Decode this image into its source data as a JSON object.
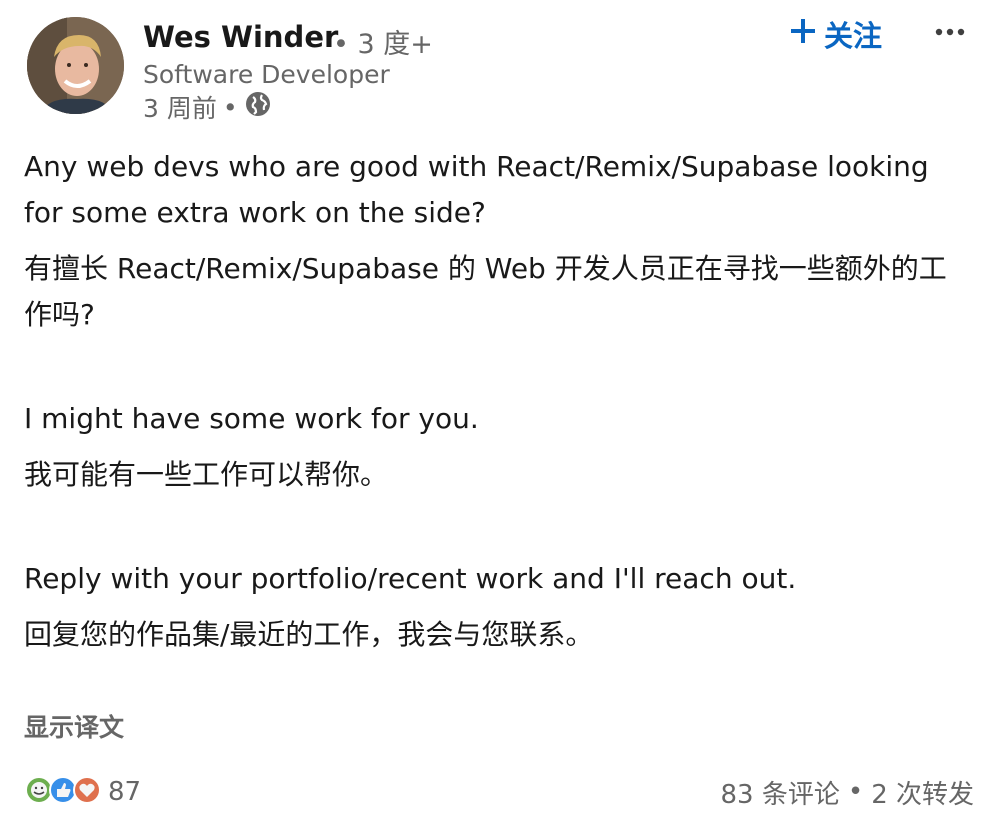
{
  "author": {
    "name": "Wes Winder",
    "degree": "• 3 度+",
    "headline": "Software Developer",
    "timestamp": "3 周前",
    "separator": "•",
    "visibility_icon": "globe-icon"
  },
  "actions": {
    "follow_label": "关注",
    "follow_icon": "plus-icon",
    "more_icon": "more-horizontal-icon"
  },
  "post": {
    "paragraphs": [
      "Any web devs who are good with React/Remix/Supabase looking for some extra work on the side?",
      "有擅长 React/Remix/Supabase 的 Web 开发人员正在寻找一些额外的工作吗?",
      "I might have some work for you.",
      "我可能有一些工作可以帮你。",
      "Reply with your portfolio/recent work and I'll reach out.",
      "回复您的作品集/最近的工作，我会与您联系。"
    ],
    "show_translation_label": "显示译文"
  },
  "social": {
    "reaction_icons": [
      "celebrate-icon",
      "like-icon",
      "love-icon"
    ],
    "reaction_count": "87",
    "comments_label": "83 条评论",
    "separator": "•",
    "reposts_label": "2 次转发"
  },
  "colors": {
    "accent": "#0a66c2",
    "text_primary": "#191919",
    "text_secondary": "#666666"
  }
}
